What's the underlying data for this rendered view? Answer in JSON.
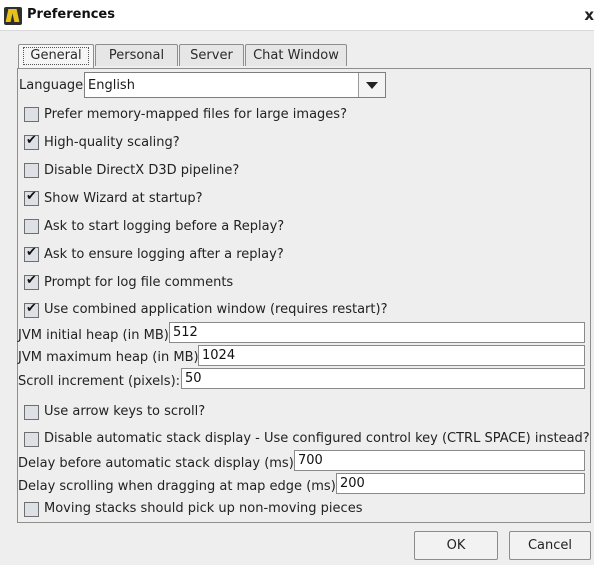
{
  "window": {
    "title": "Preferences",
    "close_glyph": "x"
  },
  "tabs": [
    {
      "label": "General",
      "active": true
    },
    {
      "label": "Personal"
    },
    {
      "label": "Server"
    },
    {
      "label": "Chat Window"
    }
  ],
  "language": {
    "label": "Language",
    "value": "English"
  },
  "checkboxes": [
    {
      "label": "Prefer memory-mapped files for large images?",
      "checked": false
    },
    {
      "label": "High-quality scaling?",
      "checked": true
    },
    {
      "label": "Disable DirectX D3D pipeline?",
      "checked": false
    },
    {
      "label": "Show Wizard at startup?",
      "checked": true
    },
    {
      "label": "Ask to start logging before a Replay?",
      "checked": false
    },
    {
      "label": "Ask to ensure logging after a replay?",
      "checked": true
    },
    {
      "label": "Prompt for log file comments",
      "checked": true
    },
    {
      "label": "Use combined application window (requires restart)?",
      "checked": true
    }
  ],
  "fields": {
    "jvm_initial": {
      "label": "JVM initial heap (in MB):",
      "value": "512"
    },
    "jvm_max": {
      "label": "JVM maximum heap (in MB):",
      "value": "1024"
    },
    "scroll_increment": {
      "label": "Scroll increment (pixels):",
      "value": "50"
    },
    "stack_delay": {
      "label": "Delay before automatic stack display (ms):",
      "value": "700"
    },
    "drag_delay": {
      "label": "Delay scrolling when dragging at map edge (ms):",
      "value": "200"
    }
  },
  "checkboxes2": [
    {
      "label": "Use arrow keys to scroll?",
      "checked": false
    },
    {
      "label": "Disable automatic stack display - Use configured control key (CTRL SPACE) instead?",
      "checked": false
    },
    {
      "label": "Moving stacks should pick up non-moving pieces",
      "checked": false
    }
  ],
  "buttons": {
    "ok": "OK",
    "cancel": "Cancel"
  }
}
